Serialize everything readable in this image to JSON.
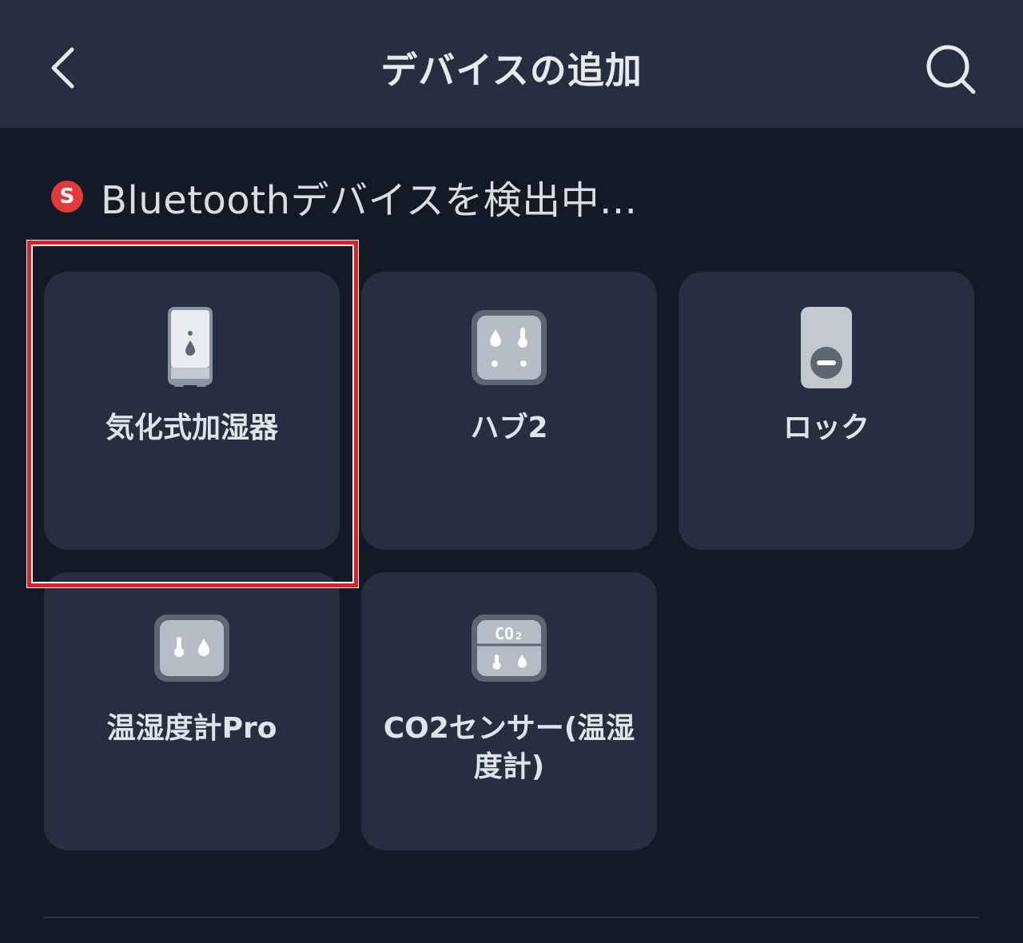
{
  "header": {
    "title": "デバイスの追加",
    "back_icon": "chevron-left-icon",
    "search_icon": "search-icon"
  },
  "scan": {
    "badge_letter": "S",
    "status_text": "Bluetoothデバイスを検出中...",
    "badge_color": "#e13a3a"
  },
  "devices": [
    {
      "label": "気化式加湿器",
      "icon": "humidifier-icon"
    },
    {
      "label": "ハブ2",
      "icon": "hub-icon"
    },
    {
      "label": "ロック",
      "icon": "lock-icon"
    },
    {
      "label": "温湿度計Pro",
      "icon": "thermo-hygrometer-icon"
    },
    {
      "label": "CO2センサー(温湿度計)",
      "icon": "co2-sensor-icon"
    }
  ],
  "co2_icon_text": "CO₂",
  "colors": {
    "background": "#141a25",
    "header": "#252f40",
    "card": "#252f40",
    "highlight": "#e01f26"
  }
}
